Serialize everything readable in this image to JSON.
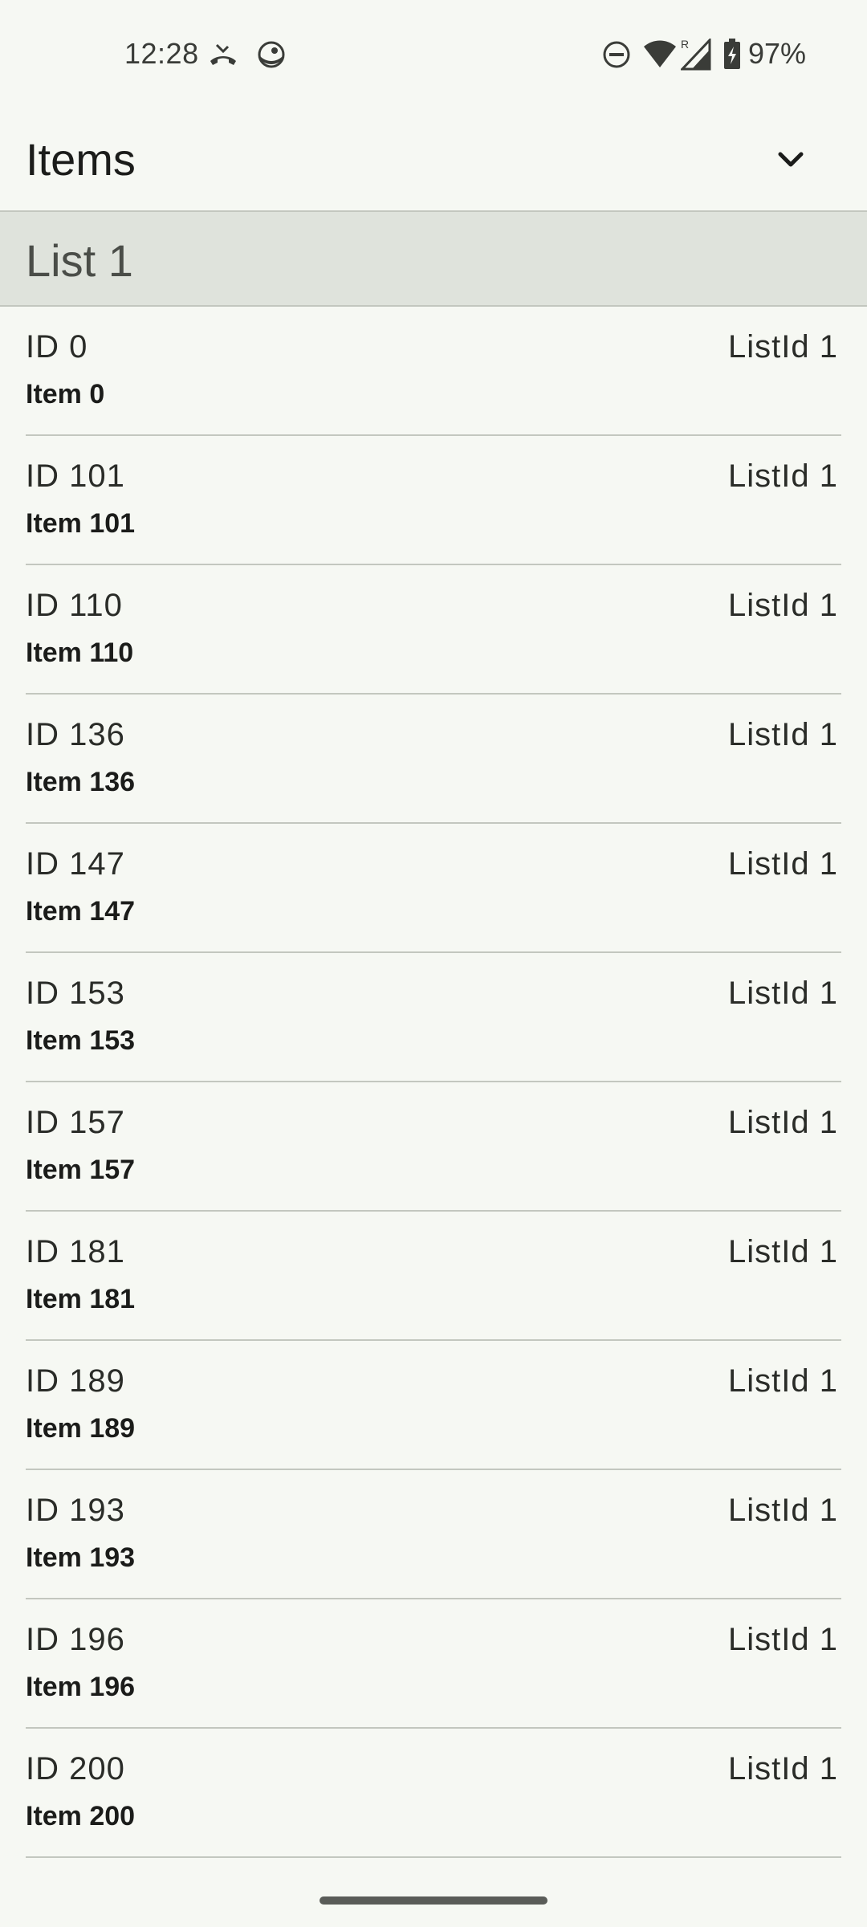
{
  "status_bar": {
    "time": "12:28",
    "battery": "97%",
    "icons": [
      "missed-call-icon",
      "vpn-icon",
      "do-not-disturb-icon",
      "wifi-icon",
      "signal-roaming-icon",
      "battery-charging-icon"
    ]
  },
  "app_bar": {
    "title": "Items",
    "expand_icon": "chevron-down-icon"
  },
  "list_header": {
    "label": "List 1"
  },
  "items": [
    {
      "id": "ID 0",
      "list_id": "ListId 1",
      "name": "Item 0"
    },
    {
      "id": "ID 101",
      "list_id": "ListId 1",
      "name": "Item 101"
    },
    {
      "id": "ID 110",
      "list_id": "ListId 1",
      "name": "Item 110"
    },
    {
      "id": "ID 136",
      "list_id": "ListId 1",
      "name": "Item 136"
    },
    {
      "id": "ID 147",
      "list_id": "ListId 1",
      "name": "Item 147"
    },
    {
      "id": "ID 153",
      "list_id": "ListId 1",
      "name": "Item 153"
    },
    {
      "id": "ID 157",
      "list_id": "ListId 1",
      "name": "Item 157"
    },
    {
      "id": "ID 181",
      "list_id": "ListId 1",
      "name": "Item 181"
    },
    {
      "id": "ID 189",
      "list_id": "ListId 1",
      "name": "Item 189"
    },
    {
      "id": "ID 193",
      "list_id": "ListId 1",
      "name": "Item 193"
    },
    {
      "id": "ID 196",
      "list_id": "ListId 1",
      "name": "Item 196"
    },
    {
      "id": "ID 200",
      "list_id": "ListId 1",
      "name": "Item 200"
    }
  ]
}
